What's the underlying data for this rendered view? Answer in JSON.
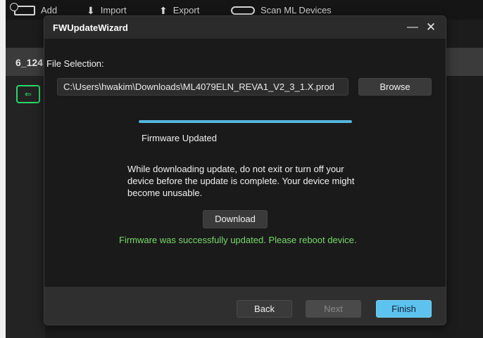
{
  "background_app": {
    "toolbar": {
      "items": [
        {
          "label": "Add",
          "icon": "add-device-icon"
        },
        {
          "label": "Import",
          "icon": "import-arrow-icon"
        },
        {
          "label": "Export",
          "icon": "export-arrow-icon"
        },
        {
          "label": "Scan ML Devices",
          "icon": "scan-icon"
        }
      ]
    },
    "device_label": "6_124",
    "device_icon": "usb-device-icon"
  },
  "dialog": {
    "title": "FWUpdateWizard",
    "minimize_glyph": "—",
    "close_glyph": "✕",
    "file_selection_label": "File Selection:",
    "file_path": "C:\\Users\\hwakim\\Downloads\\ML4079ELN_REVA1_V2_3_1.X.prod",
    "browse_label": "Browse",
    "progress_fraction": 1.0,
    "status_text": "Firmware Updated",
    "warning_text": "While downloading update, do not exit or turn off your device before the update is complete. Your device might become unusable.",
    "download_label": "Download",
    "success_message": "Firmware was successfully updated. Please reboot device.",
    "footer": {
      "back_label": "Back",
      "next_label": "Next",
      "finish_label": "Finish"
    }
  },
  "colors": {
    "accent": "#5cc3ee",
    "progress": "#56b6e0",
    "success": "#78d96b",
    "device_icon": "#2bd66b"
  }
}
